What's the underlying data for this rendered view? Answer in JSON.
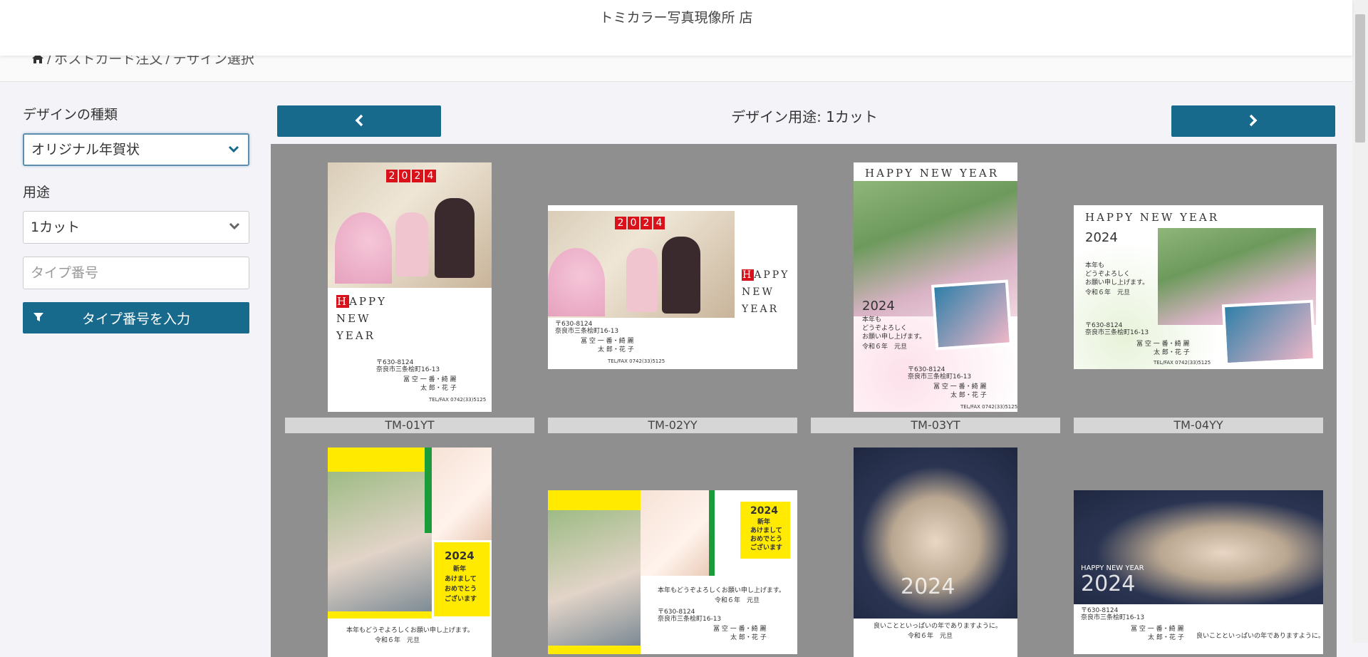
{
  "header": {
    "store_name": "トミカラー写真現像所 店"
  },
  "breadcrumb": {
    "items": [
      "ポストカード注文",
      "デザイン選択"
    ],
    "separator": "/"
  },
  "sidebar": {
    "design_type_label": "デザインの種類",
    "design_type_value": "オリジナル年賀状",
    "usage_label": "用途",
    "usage_value": "1カット",
    "type_number_placeholder": "タイプ番号",
    "enter_button_label": "タイプ番号を入力"
  },
  "main": {
    "title": "デザイン用途: 1カット",
    "designs": [
      {
        "code": "TM-01YT"
      },
      {
        "code": "TM-02YY"
      },
      {
        "code": "TM-03YT"
      },
      {
        "code": "TM-04YY"
      },
      {
        "code": ""
      },
      {
        "code": ""
      },
      {
        "code": ""
      },
      {
        "code": ""
      }
    ]
  },
  "card_text": {
    "year": [
      "2",
      "0",
      "2",
      "4"
    ],
    "year_full": "2024",
    "happy": "APPY",
    "h_letter": "H",
    "new": "NEW",
    "yr": "YEAR",
    "happy_new_year": "HAPPY NEW YEAR",
    "zip": "〒630-8124",
    "address": "奈良市三条桧町16-13",
    "names_a": "冨 空  一 番・綺 麗",
    "names_b": "太 郎・花 子",
    "tel": "TEL/FAX 0742(33)5125",
    "greeting_1": "本年も",
    "greeting_2": "どうぞよろしく",
    "greeting_3": "お願い申し上げます。",
    "era": "令和６年　元旦",
    "shinnen": "新年",
    "akemashite": "あけまして",
    "omedetou": "おめでとう",
    "gozaimasu": "ございます",
    "long_greeting": "本年もどうぞよろしくお願い申し上げます。",
    "good_year": "良いことといっぱいの年でありますように。"
  },
  "colors": {
    "primary": "#176a8c",
    "grid_bg": "#8f8f8f",
    "accent_red": "#d8111b",
    "accent_yellow": "#ffea00",
    "accent_green": "#1a9c3a"
  }
}
